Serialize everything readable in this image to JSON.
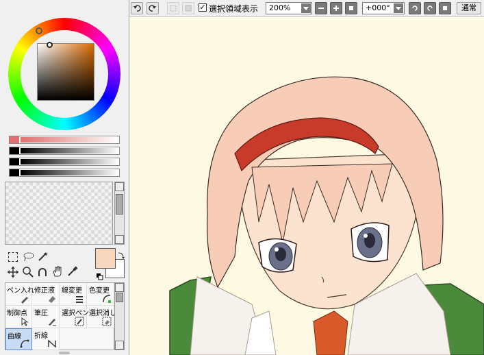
{
  "toolbar": {
    "selection_checkbox_label": "選択領域表示",
    "zoom_value": "200%",
    "rotation_value": "+000°",
    "blend_mode": "通常"
  },
  "tools": [
    {
      "label": "ペン入れ",
      "icon": "pen-icon"
    },
    {
      "label": "修正液",
      "icon": "eraser-icon"
    },
    {
      "label": "線変更",
      "icon": "line-change-icon"
    },
    {
      "label": "色変更",
      "icon": "color-change-icon"
    },
    {
      "label": "制御点",
      "icon": "control-point-icon"
    },
    {
      "label": "筆圧",
      "icon": "pressure-icon"
    },
    {
      "label": "選択ペン",
      "icon": "select-pen-icon"
    },
    {
      "label": "選択消し",
      "icon": "select-erase-icon"
    },
    {
      "label": "曲線",
      "icon": "curve-icon",
      "selected": true
    },
    {
      "label": "折線",
      "icon": "polyline-icon"
    }
  ],
  "colors": {
    "foreground": "#f7d7bd",
    "background": "#ffffff",
    "canvas_bg": "#fdf9e3",
    "accent_red": "#e07070",
    "hue_marker": "#d97a2b"
  }
}
